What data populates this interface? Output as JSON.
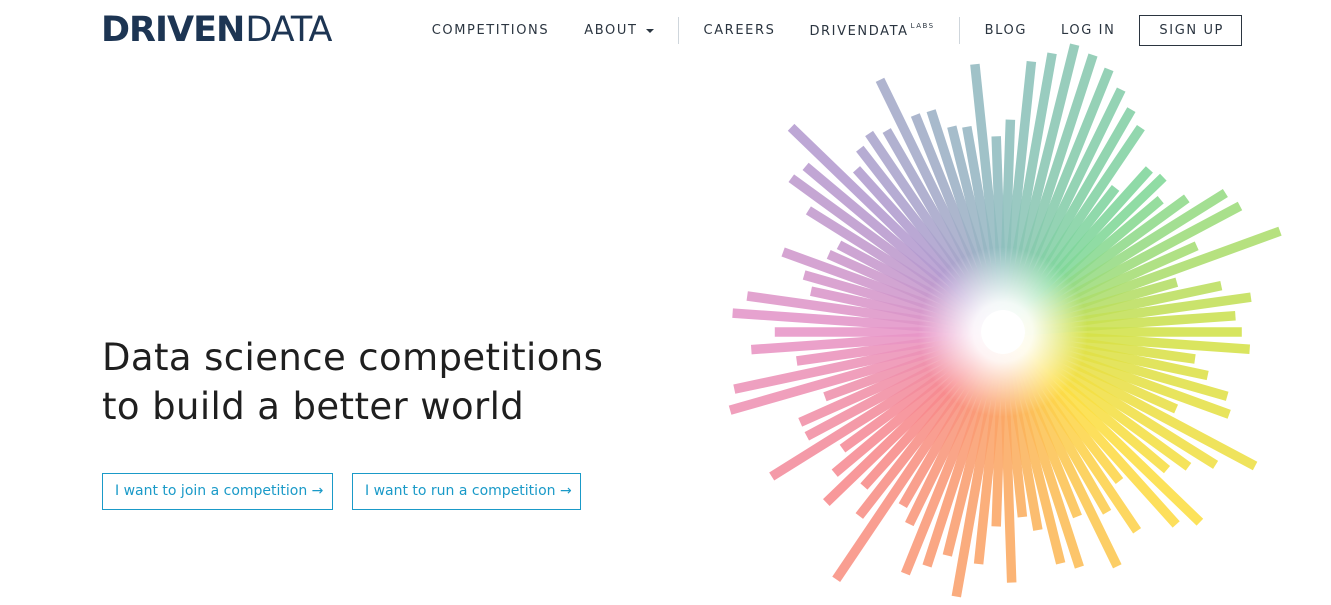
{
  "header": {
    "logo": {
      "part_bold": "DRIVEN",
      "part_light": "DATA",
      "stripe_colors": [
        "#a98bc7",
        "#8ad0b5",
        "#f59d92",
        "#f3d77e",
        "#a6dcc3"
      ]
    },
    "nav": {
      "competitions": "COMPETITIONS",
      "about": "ABOUT",
      "careers": "CAREERS",
      "drivendata_labs": "DRIVENDATA",
      "labs_sup": "LABS",
      "blog": "BLOG",
      "login": "LOG IN",
      "signup": "SIGN UP"
    }
  },
  "hero": {
    "headline_line1": "Data science competitions",
    "headline_line2": "to build a better world",
    "join_button": "I want to join a competition →",
    "run_button": "I want to run a competition →"
  },
  "burst": {
    "name": "radial-color-bar-burst",
    "bar_count": 90,
    "hue_stops": [
      {
        "angle": 0,
        "color": "#d2e24a"
      },
      {
        "angle": 45,
        "color": "#fddf44"
      },
      {
        "angle": 90,
        "color": "#fba864"
      },
      {
        "angle": 135,
        "color": "#f88a8c"
      },
      {
        "angle": 180,
        "color": "#e896c8"
      },
      {
        "angle": 225,
        "color": "#b39bd0"
      },
      {
        "angle": 270,
        "color": "#8fbfbf"
      },
      {
        "angle": 315,
        "color": "#7fd89a"
      },
      {
        "angle": 360,
        "color": "#d2e24a"
      }
    ]
  },
  "colors": {
    "brand_navy": "#1d3553",
    "link_blue": "#1a9ac8",
    "text": "#1f1f1f"
  }
}
